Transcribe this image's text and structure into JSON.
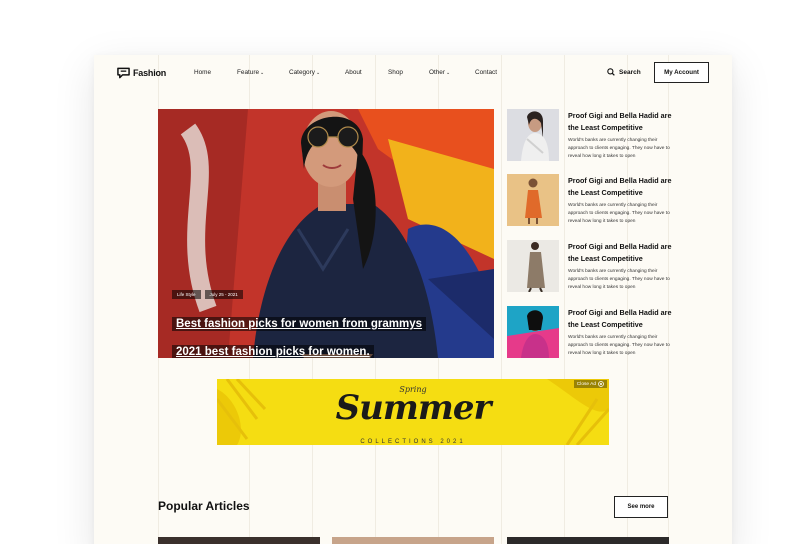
{
  "brand": {
    "name": "Fashion"
  },
  "nav": {
    "items": [
      {
        "label": "Home",
        "caret": ""
      },
      {
        "label": "Feature",
        "caret": "⌄"
      },
      {
        "label": "Category",
        "caret": "⌄"
      },
      {
        "label": "About",
        "caret": ""
      },
      {
        "label": "Shop",
        "caret": ""
      },
      {
        "label": "Other",
        "caret": "⌄"
      },
      {
        "label": "Contact",
        "caret": ""
      }
    ],
    "search_label": "Search",
    "account_label": "My Account"
  },
  "hero": {
    "tag_category": "Life Style",
    "tag_date": "July 25 - 2021",
    "title": "Best fashion picks for women from grammys 2021 best fashion picks for women."
  },
  "side_articles": [
    {
      "title": "Proof Gigi and Bella Hadid are the Least Competitive",
      "desc": "World's banks are currently changing their approach to clients engaging. They now have to reveal how long it takes to open"
    },
    {
      "title": "Proof Gigi and Bella Hadid are the Least Competitive",
      "desc": "World's banks are currently changing their approach to clients engaging. They now have to reveal how long it takes to open"
    },
    {
      "title": "Proof Gigi and Bella Hadid are the Least Competitive",
      "desc": "World's banks are currently changing their approach to clients engaging. They now have to reveal how long it takes to open"
    },
    {
      "title": "Proof Gigi and Bella Hadid are the Least Competitive",
      "desc": "World's banks are currently changing their approach to clients engaging. They now have to reveal how long it takes to open"
    }
  ],
  "ad": {
    "script": "Spring",
    "main": "Summer",
    "sub": "COLLECTIONS 2021",
    "close_label": "Close Ad"
  },
  "popular": {
    "title": "Popular Articles",
    "see_more_label": "See more"
  },
  "colors": {
    "page_bg": "#fdfbf5",
    "ad_yellow": "#f5dd12",
    "hero_red": "#c2342a"
  }
}
